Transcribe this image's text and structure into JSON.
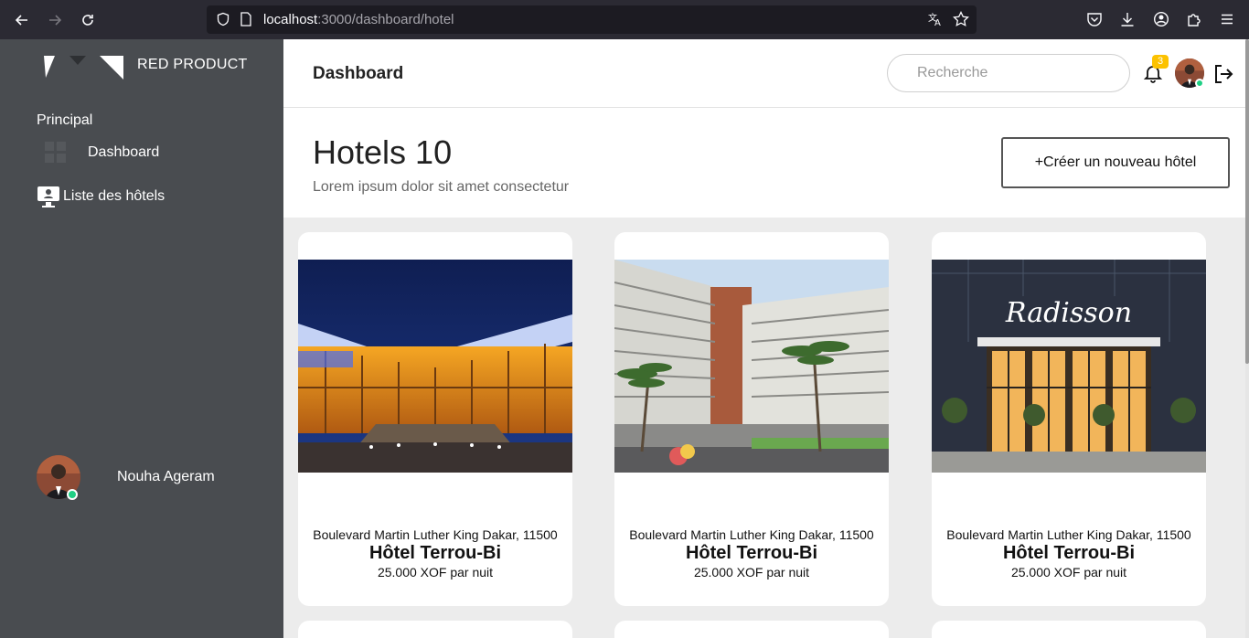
{
  "browser": {
    "url_host": "localhost",
    "url_path": ":3000/dashboard/hotel"
  },
  "sidebar": {
    "brand": "RED PRODUCT",
    "section": "Principal",
    "items": [
      {
        "label": "Dashboard",
        "icon": "grid-icon"
      },
      {
        "label": "Liste des hôtels",
        "icon": "hotel-monitor-icon"
      }
    ],
    "user_name": "Nouha Ageram"
  },
  "header": {
    "title": "Dashboard",
    "search_placeholder": "Recherche",
    "notification_count": "3"
  },
  "hotels": {
    "title": "Hotels 10",
    "subtitle": "Lorem ipsum dolor sit amet consectetur",
    "create_label": "+Créer un nouveau hôtel"
  },
  "cards": [
    {
      "address": "Boulevard Martin Luther King Dakar, 11500",
      "name": "Hôtel Terrou-Bi",
      "price": "25.000 XOF par nuit"
    },
    {
      "address": "Boulevard Martin Luther King Dakar, 11500",
      "name": "Hôtel Terrou-Bi",
      "price": "25.000 XOF par nuit"
    },
    {
      "address": "Boulevard Martin Luther King Dakar, 11500",
      "name": "Hôtel Terrou-Bi",
      "price": "25.000 XOF par nuit"
    }
  ],
  "hotel_photo_sign": "Radisson",
  "colors": {
    "sidebar_bg": "#494c50",
    "badge": "#fcc200",
    "online": "#1fd085"
  }
}
